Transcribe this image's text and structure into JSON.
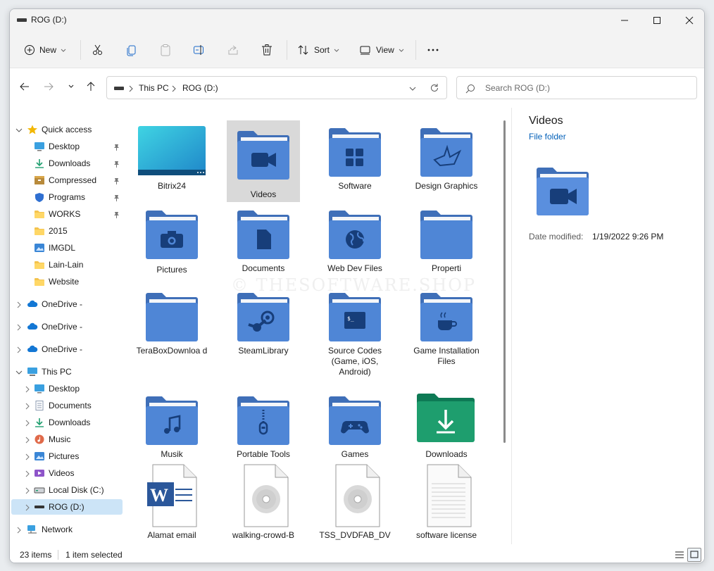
{
  "window": {
    "title": "ROG (D:)"
  },
  "toolbar": {
    "new_label": "New",
    "sort_label": "Sort",
    "view_label": "View"
  },
  "address": {
    "root": "This PC",
    "current": "ROG (D:)",
    "search_placeholder": "Search ROG (D:)"
  },
  "sidebar": {
    "quick_access": "Quick access",
    "quick_items": [
      "Desktop",
      "Downloads",
      "Compressed",
      "Programs",
      "WORKS",
      "2015",
      "IMGDL",
      "Lain-Lain",
      "Website"
    ],
    "onedrive": [
      "OneDrive -",
      "OneDrive -",
      "OneDrive -"
    ],
    "this_pc": "This PC",
    "pc_items": [
      "Desktop",
      "Documents",
      "Downloads",
      "Music",
      "Pictures",
      "Videos",
      "Local Disk (C:)",
      "ROG (D:)"
    ],
    "network": "Network"
  },
  "files": [
    {
      "name": "Bitrix24",
      "icon": "bitrix-thumbnail"
    },
    {
      "name": "Videos",
      "icon": "video-camera-icon"
    },
    {
      "name": "Software",
      "icon": "grid-icon"
    },
    {
      "name": "Design Graphics",
      "icon": "origami-crane-icon"
    },
    {
      "name": "Pictures",
      "icon": "camera-icon"
    },
    {
      "name": "Documents",
      "icon": "document-icon"
    },
    {
      "name": "Web Dev Files",
      "icon": "globe-icon"
    },
    {
      "name": "Properti",
      "icon": "plain-folder"
    },
    {
      "name": "TeraBoxDownloa d",
      "icon": "plain-folder"
    },
    {
      "name": "SteamLibrary",
      "icon": "steam-icon"
    },
    {
      "name": "Source Codes (Game, iOS, Android)",
      "icon": "terminal-icon"
    },
    {
      "name": "Game Installation Files",
      "icon": "coffee-cup-icon"
    },
    {
      "name": "Musik",
      "icon": "music-note-icon"
    },
    {
      "name": "Portable Tools",
      "icon": "zipper-icon"
    },
    {
      "name": "Games",
      "icon": "gamepad-icon"
    },
    {
      "name": "Downloads",
      "icon": "download-arrow-icon"
    },
    {
      "name": "Alamat email",
      "icon": "word-doc-icon"
    },
    {
      "name": "walking-crowd-B",
      "icon": "disc-file-icon"
    },
    {
      "name": "TSS_DVDFAB_DV",
      "icon": "disc-file-icon"
    },
    {
      "name": "software license",
      "icon": "text-file-icon"
    }
  ],
  "details": {
    "name": "Videos",
    "type": "File folder",
    "date_label": "Date modified:",
    "date_value": "1/19/2022 9:26 PM"
  },
  "status": {
    "items": "23 items",
    "selected": "1 item selected"
  },
  "watermark": "© THESOFTWARE.SHOP",
  "colors": {
    "folder_blue": "#4f86d6",
    "folder_tab": "#3f6fb8",
    "folder_green": "#1e9e6e",
    "selection": "#cce4f7",
    "accent": "#005fb8"
  }
}
